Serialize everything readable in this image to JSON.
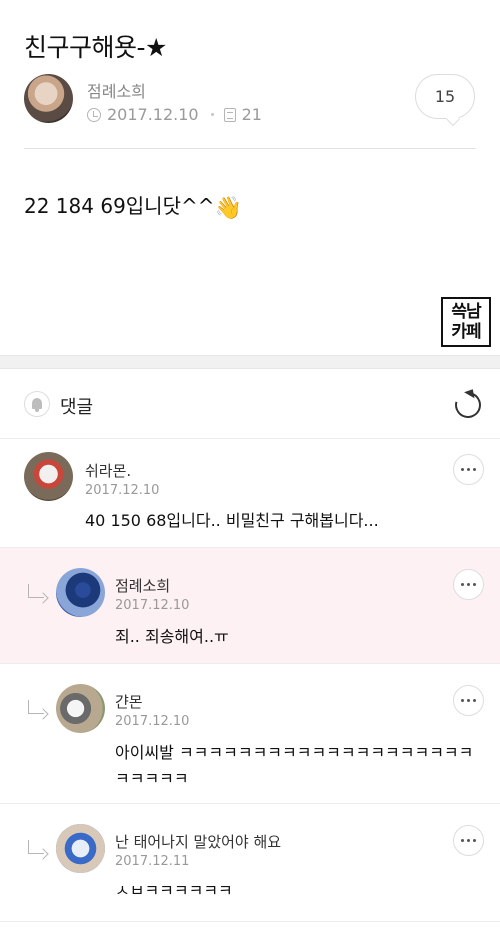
{
  "post": {
    "title": "친구구해욧-★",
    "author": "점례소희",
    "date": "2017.12.10",
    "views": "21",
    "comment_count": "15",
    "body": "22 184 69입니닷^^",
    "emoji": "👋",
    "cafe_logo_line1": "쓱남",
    "cafe_logo_line2": "카페"
  },
  "comments_section": {
    "label": "댓글"
  },
  "comments": [
    {
      "author": "쉬라몬.",
      "date": "2017.12.10",
      "text": "40 150 68입니다.. 비밀친구 구해봅니다..."
    },
    {
      "author": "점례소희",
      "date": "2017.12.10",
      "text": "죄.. 죄송해여..ㅠ"
    },
    {
      "author": "갼몬",
      "date": "2017.12.10",
      "text": "아이씨발 ㅋㅋㅋㅋㅋㅋㅋㅋㅋㅋㅋㅋㅋㅋㅋㅋㅋㅋㅋㅋㅋㅋㅋㅋㅋ"
    },
    {
      "author": "난 태어나지 말았어야 해요",
      "date": "2017.12.11",
      "text": "ㅅㅂㅋㅋㅋㅋㅋㅋ"
    }
  ]
}
